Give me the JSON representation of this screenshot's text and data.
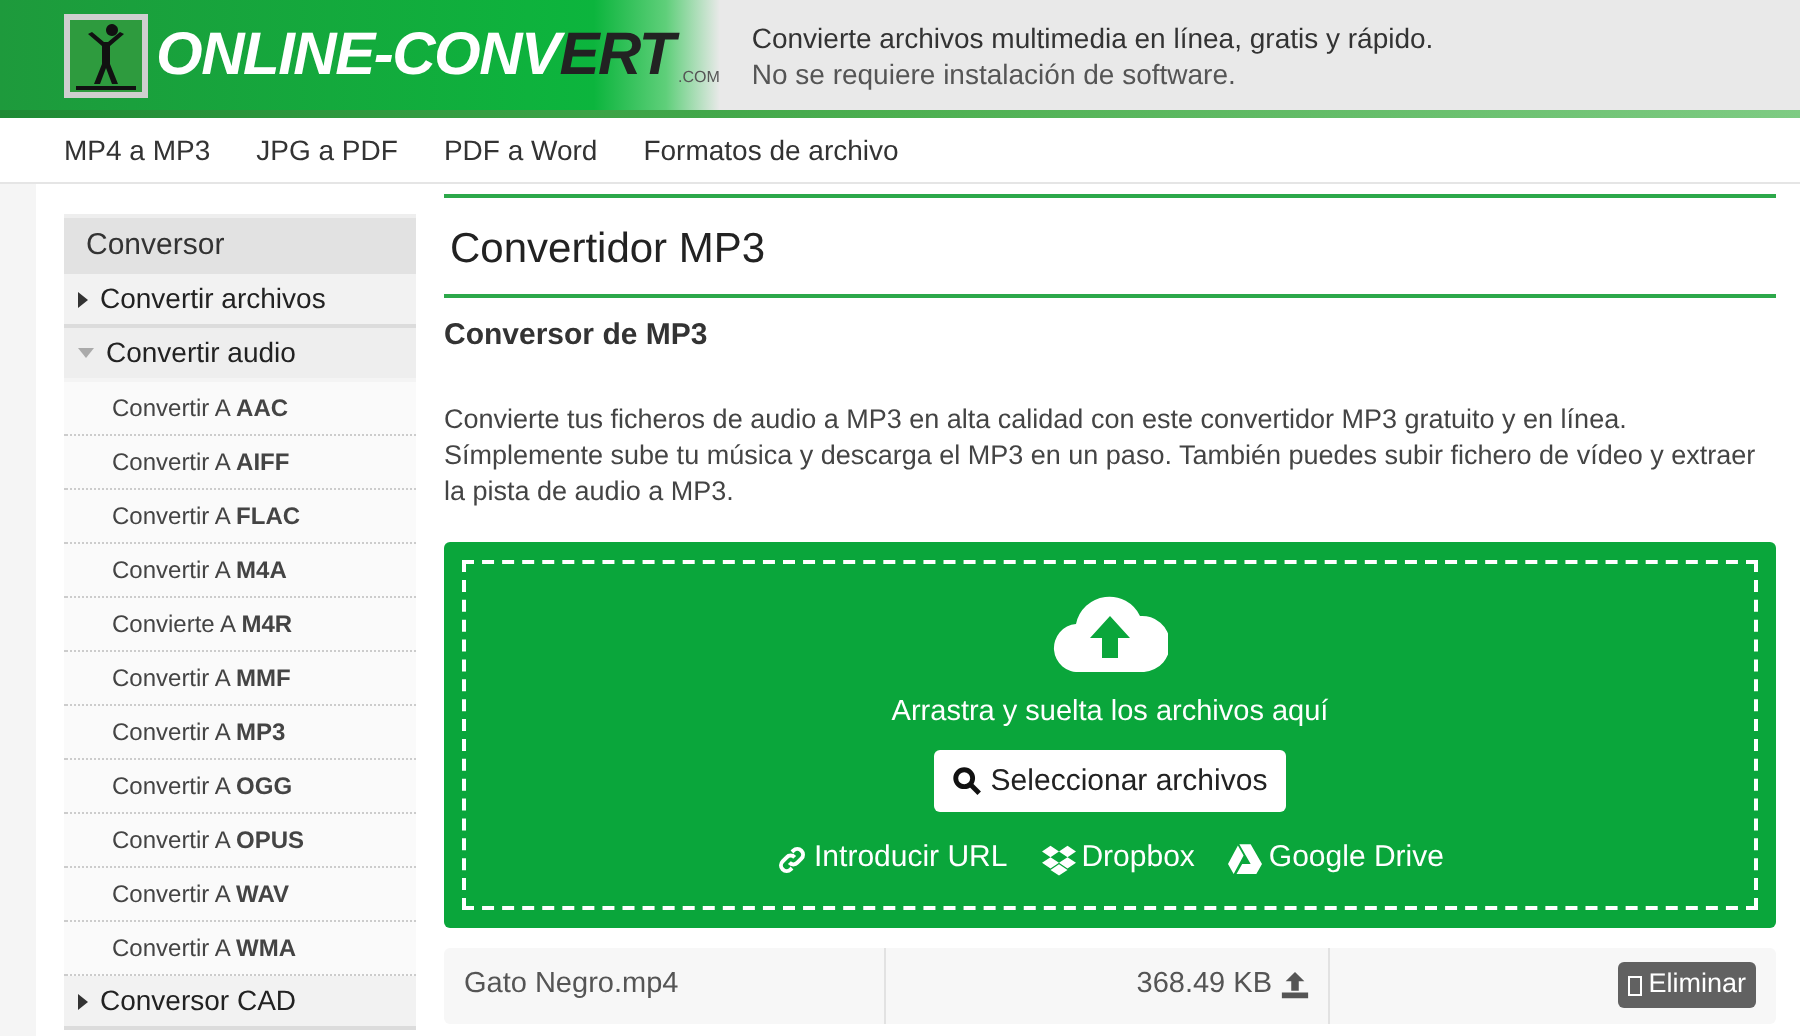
{
  "header": {
    "logo": {
      "first": "ONLINE-CONV",
      "second": "ERT",
      "suffix": ".COM"
    },
    "tagline": [
      "Convierte archivos multimedia en línea, gratis y rápido.",
      "No se requiere instalación de software."
    ]
  },
  "nav": [
    "MP4 a MP3",
    "JPG a PDF",
    "PDF a Word",
    "Formatos de archivo"
  ],
  "sidebar": {
    "title": "Conversor",
    "items": [
      {
        "label": "Convertir archivos",
        "expanded": false
      },
      {
        "label": "Convertir audio",
        "expanded": true,
        "children": [
          {
            "label": "Convertir A **AAC**"
          },
          {
            "label": "Convertir A **AIFF**"
          },
          {
            "label": "Convertir A **FLAC**"
          },
          {
            "label": "Convertir A **M4A**"
          },
          {
            "label": "Convierte A **M4R**"
          },
          {
            "label": "Convertir A **MMF**"
          },
          {
            "label": "Convertir A **MP3**"
          },
          {
            "label": "Convertir A **OGG**"
          },
          {
            "label": "Convertir A **OPUS**"
          },
          {
            "label": "Convertir A **WAV**"
          },
          {
            "label": "Convertir A **WMA**"
          }
        ]
      },
      {
        "label": "Conversor CAD",
        "expanded": false
      }
    ]
  },
  "main": {
    "title": "Convertidor MP3",
    "subtitle": "Conversor de MP3",
    "description": "Convierte tus ficheros de audio a MP3 en alta calidad con este convertidor MP3 gratuito y en línea. Símplemente sube tu música y descarga el MP3 en un paso. También puedes subir fichero de vídeo y extraer la pista de audio a MP3.",
    "dropzone": {
      "hint": "Arrastra y suelta los archivos aquí",
      "button": "Seleccionar archivos",
      "sources": [
        {
          "kind": "url",
          "label": "Introducir URL"
        },
        {
          "kind": "dropbox",
          "label": "Dropbox"
        },
        {
          "kind": "drive",
          "label": "Google Drive"
        }
      ]
    },
    "files": [
      {
        "name": "Gato Negro.mp4",
        "size": "368.49 KB",
        "delete": "Eliminar"
      }
    ]
  }
}
